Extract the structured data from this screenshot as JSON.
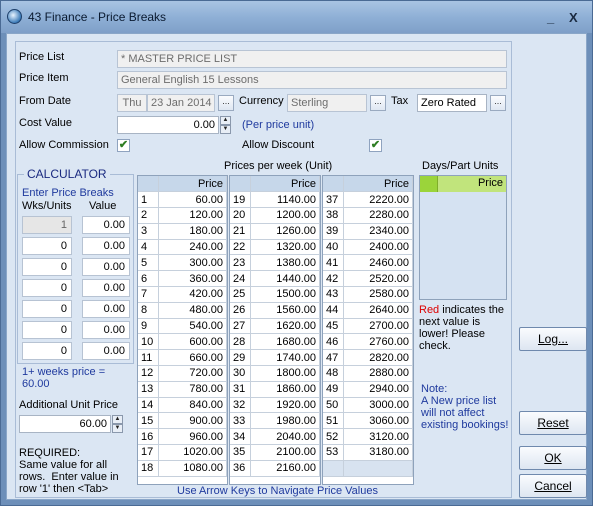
{
  "window": {
    "title": "43 Finance - Price Breaks",
    "minimize": "_",
    "close": "X"
  },
  "form": {
    "price_list_label": "Price List",
    "price_list_value": "* MASTER PRICE LIST",
    "price_item_label": "Price Item",
    "price_item_value": "General English 15 Lessons",
    "from_date_label": "From Date",
    "from_date_day": "Thu",
    "from_date_value": "23 Jan 2014",
    "currency_label": "Currency",
    "currency_value": "Sterling",
    "tax_label": "Tax",
    "tax_value": "Zero Rated",
    "cost_value_label": "Cost Value",
    "cost_value": "0.00",
    "per_unit_note": "(Per price unit)",
    "allow_commission_label": "Allow Commission",
    "allow_commission_checked": "✔",
    "allow_discount_label": "Allow Discount",
    "allow_discount_checked": "✔",
    "ellipsis": "..."
  },
  "calculator": {
    "title": "CALCULATOR",
    "enter_label": "Enter Price Breaks",
    "col_wks": "Wks/Units",
    "col_value": "Value",
    "rows": [
      {
        "wks": "1",
        "value": "0.00"
      },
      {
        "wks": "0",
        "value": "0.00"
      },
      {
        "wks": "0",
        "value": "0.00"
      },
      {
        "wks": "0",
        "value": "0.00"
      },
      {
        "wks": "0",
        "value": "0.00"
      },
      {
        "wks": "0",
        "value": "0.00"
      },
      {
        "wks": "0",
        "value": "0.00"
      }
    ],
    "weeks_price_note": "1+ weeks price = 60.00"
  },
  "additional_unit": {
    "label": "Additional Unit Price",
    "value": "60.00"
  },
  "required_note": "REQUIRED:\nSame value for all rows.  Enter value in row '1' then <Tab>",
  "prices": {
    "title": "Prices per week (Unit)",
    "header": "Price",
    "col1": [
      [
        "1",
        "60.00"
      ],
      [
        "2",
        "120.00"
      ],
      [
        "3",
        "180.00"
      ],
      [
        "4",
        "240.00"
      ],
      [
        "5",
        "300.00"
      ],
      [
        "6",
        "360.00"
      ],
      [
        "7",
        "420.00"
      ],
      [
        "8",
        "480.00"
      ],
      [
        "9",
        "540.00"
      ],
      [
        "10",
        "600.00"
      ],
      [
        "11",
        "660.00"
      ],
      [
        "12",
        "720.00"
      ],
      [
        "13",
        "780.00"
      ],
      [
        "14",
        "840.00"
      ],
      [
        "15",
        "900.00"
      ],
      [
        "16",
        "960.00"
      ],
      [
        "17",
        "1020.00"
      ],
      [
        "18",
        "1080.00"
      ]
    ],
    "col2": [
      [
        "19",
        "1140.00"
      ],
      [
        "20",
        "1200.00"
      ],
      [
        "21",
        "1260.00"
      ],
      [
        "22",
        "1320.00"
      ],
      [
        "23",
        "1380.00"
      ],
      [
        "24",
        "1440.00"
      ],
      [
        "25",
        "1500.00"
      ],
      [
        "26",
        "1560.00"
      ],
      [
        "27",
        "1620.00"
      ],
      [
        "28",
        "1680.00"
      ],
      [
        "29",
        "1740.00"
      ],
      [
        "30",
        "1800.00"
      ],
      [
        "31",
        "1860.00"
      ],
      [
        "32",
        "1920.00"
      ],
      [
        "33",
        "1980.00"
      ],
      [
        "34",
        "2040.00"
      ],
      [
        "35",
        "2100.00"
      ],
      [
        "36",
        "2160.00"
      ]
    ],
    "col3": [
      [
        "37",
        "2220.00"
      ],
      [
        "38",
        "2280.00"
      ],
      [
        "39",
        "2340.00"
      ],
      [
        "40",
        "2400.00"
      ],
      [
        "41",
        "2460.00"
      ],
      [
        "42",
        "2520.00"
      ],
      [
        "43",
        "2580.00"
      ],
      [
        "44",
        "2640.00"
      ],
      [
        "45",
        "2700.00"
      ],
      [
        "46",
        "2760.00"
      ],
      [
        "47",
        "2820.00"
      ],
      [
        "48",
        "2880.00"
      ],
      [
        "49",
        "2940.00"
      ],
      [
        "50",
        "3000.00"
      ],
      [
        "51",
        "3060.00"
      ],
      [
        "52",
        "3120.00"
      ],
      [
        "53",
        "3180.00"
      ]
    ],
    "footer": "Use Arrow Keys to Navigate Price Values"
  },
  "days_part": {
    "title": "Days/Part Units",
    "header": "Price",
    "note_red_word": "Red",
    "note_rest": " indicates the next value is lower!  Please check.",
    "note_title": "Note:",
    "note_body": "A New price list will not affect existing bookings!"
  },
  "buttons": {
    "log": "Log...",
    "reset": "Reset",
    "ok": "OK",
    "cancel": "Cancel"
  },
  "colors": {
    "accent_blue": "#1f3a9e",
    "red_note": "#dd0000",
    "check_green": "#2e7d22"
  }
}
